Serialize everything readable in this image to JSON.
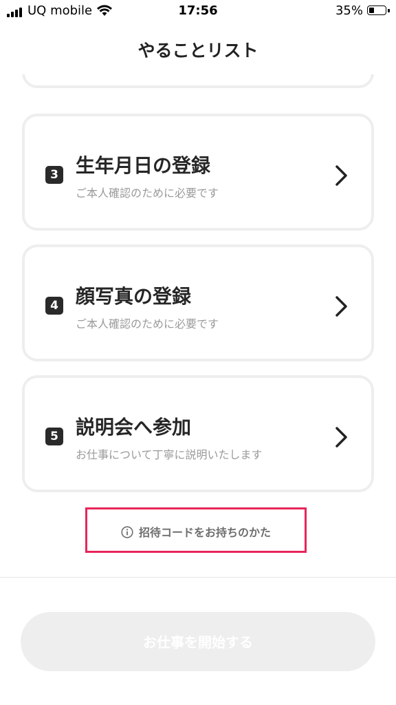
{
  "status_bar": {
    "carrier": "UQ mobile",
    "time": "17:56",
    "battery_percent": "35%",
    "battery_level": 0.35
  },
  "header": {
    "title": "やることリスト"
  },
  "tasks": [
    {
      "number": "3",
      "title": "生年月日の登録",
      "subtitle": "ご本人確認のために必要です"
    },
    {
      "number": "4",
      "title": "顔写真の登録",
      "subtitle": "ご本人確認のために必要です"
    },
    {
      "number": "5",
      "title": "説明会へ参加",
      "subtitle": "お仕事について丁寧に説明いたします"
    }
  ],
  "invite_link": {
    "label": "招待コードをお持ちのかた",
    "icon": "info-icon",
    "highlight_color": "#e8245a"
  },
  "footer": {
    "start_button_label": "お仕事を開始する",
    "button_state": "disabled"
  }
}
